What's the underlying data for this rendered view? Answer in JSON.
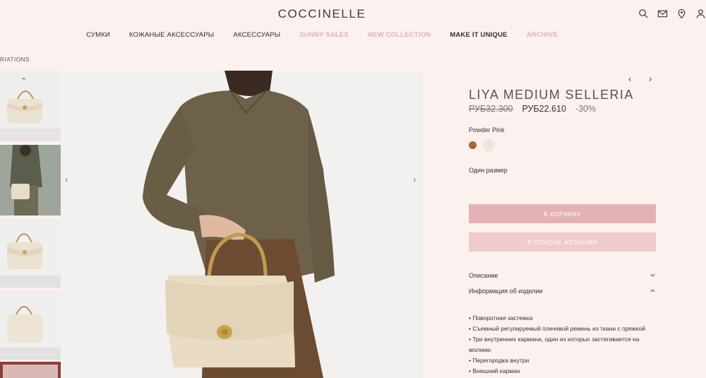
{
  "header": {
    "logo": "COCCINELLE",
    "icons": [
      "search-icon",
      "mail-icon",
      "location-icon",
      "user-icon"
    ]
  },
  "nav": {
    "items": [
      {
        "label": "СУМКИ",
        "style": "normal"
      },
      {
        "label": "КОЖАНЫЕ АКСЕССУАРЫ",
        "style": "normal"
      },
      {
        "label": "АКСЕССУАРЫ",
        "style": "normal"
      },
      {
        "label": "SUNNY SALES",
        "style": "pink"
      },
      {
        "label": "NEW COLLECTION",
        "style": "pink"
      },
      {
        "label": "MAKE IT UNIQUE",
        "style": "bold"
      },
      {
        "label": "ARCHIVE",
        "style": "pink"
      }
    ]
  },
  "breadcrumb": "RIATIONS",
  "gallery": {
    "prev_arrow": "‹",
    "next_arrow": "›",
    "thumb_up_arrow": "⌃"
  },
  "product": {
    "prev": "‹",
    "next": "›",
    "title": "LIYA MEDIUM SELLERIA",
    "old_price": "РУБ32.300",
    "new_price": "РУБ22.610",
    "discount": "-30%",
    "color_label": "Powder Pink",
    "colors": [
      "#a8643a",
      "#ede3d6"
    ],
    "size_label": "Один размер",
    "add_to_cart": "В КОРЗИНУ",
    "add_to_wishlist": "В СПИСОК ЖЕЛАНИЙ"
  },
  "accordion": {
    "description": "Описание",
    "info": "Информация об изделии",
    "details": [
      "• Поворотная застежка",
      "• Съемный регулируемый плечевой ремень из ткани с пряжкой",
      "• Три внутренних кармана, один из которых застегивается на молнию",
      "• Перегородка внутри",
      "• Внешний карман"
    ]
  },
  "colors": {
    "background": "#fbf1ee",
    "button_primary": "#e4b2b6",
    "button_secondary": "#efcbcd",
    "nav_accent": "#dfb3b6"
  }
}
